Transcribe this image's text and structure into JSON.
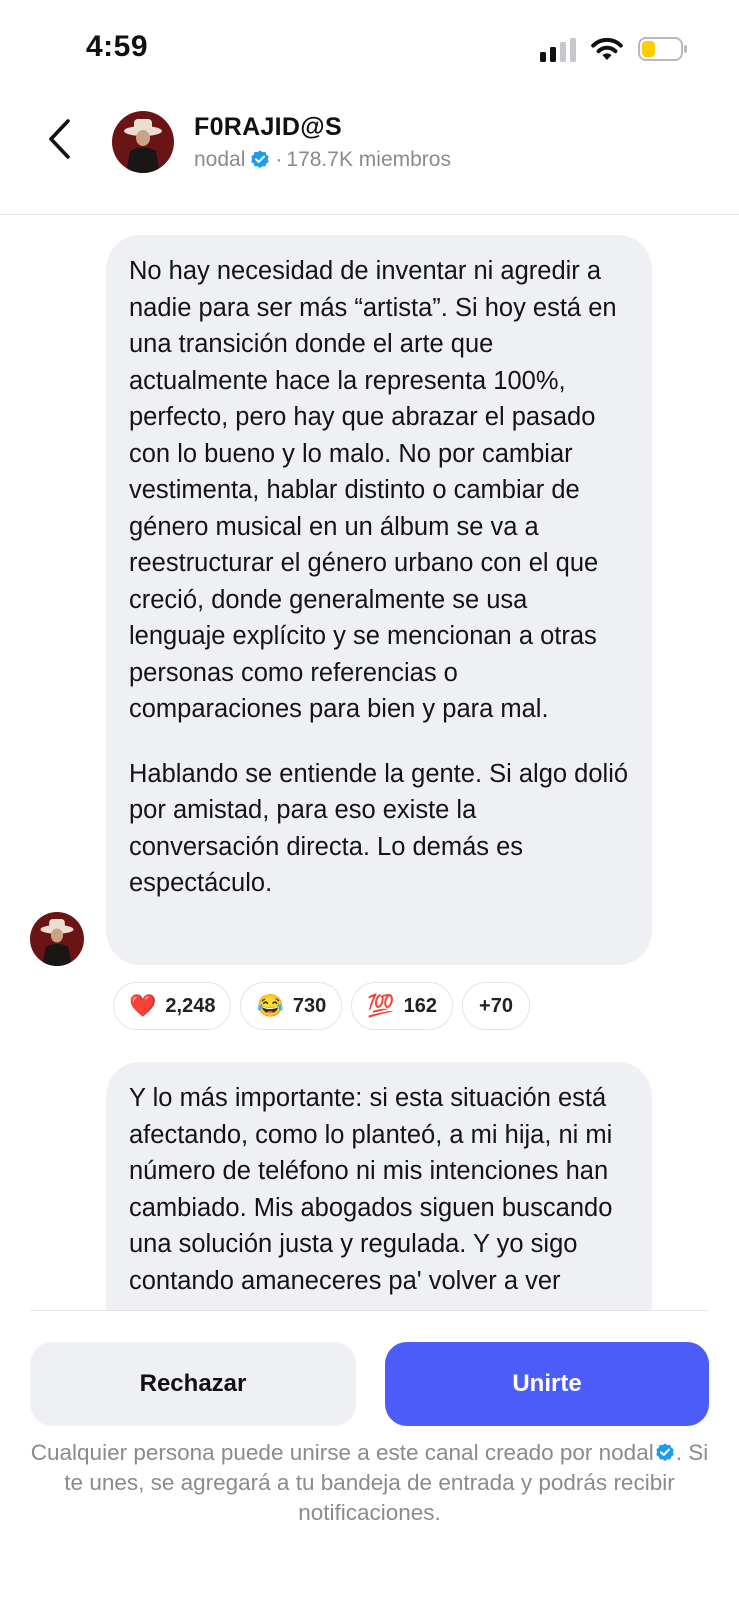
{
  "status_bar": {
    "time": "4:59"
  },
  "header": {
    "title": "F0RAJID@S",
    "creator": "nodal",
    "separator": "·",
    "members": "178.7K miembros"
  },
  "messages": [
    {
      "paragraphs": [
        "No hay necesidad de inventar ni agredir a nadie para ser más “artista”. Si hoy está en una transición donde el arte que actualmente hace la representa 100%, perfecto, pero hay que abrazar el pasado con lo bueno y lo malo. No por cambiar vestimenta, hablar distinto o cambiar de género musical en un álbum se va a reestructurar el género urbano con el que creció, donde generalmente se usa lenguaje explícito y se mencionan a otras personas como referencias o comparaciones para bien y para mal.",
        "Hablando se entiende la gente. Si algo dolió por amistad, para eso existe la conversación directa. Lo demás es espectáculo."
      ],
      "reactions": [
        {
          "emoji": "❤️",
          "count": "2,248"
        },
        {
          "emoji": "😂",
          "count": "730"
        },
        {
          "emoji": "💯",
          "count": "162"
        }
      ],
      "more_reactions": "+70"
    },
    {
      "paragraphs": [
        "Y lo más importante: si esta situación está afectando, como lo planteó, a mi hija, ni mi número de teléfono ni mis intenciones han cambiado. Mis abogados siguen buscando una solución justa y regulada. Y yo sigo contando amaneceres pa' volver a ver"
      ]
    }
  ],
  "actions": {
    "reject_label": "Rechazar",
    "join_label": "Unirte"
  },
  "footnote": {
    "before": "Cualquier persona puede unirse a este canal creado por",
    "creator": "nodal",
    "after": ". Si te unes, se agregará a tu bandeja de entrada y podrás recibir notificaciones."
  },
  "colors": {
    "accent": "#4c5cf8",
    "verified": "#1d9bf0",
    "bubble": "#eef0f3",
    "muted_text": "#8a8a8f",
    "battery_fill": "#ffcc00"
  },
  "icons": {
    "back": "chevron-left-icon",
    "verified": "verified-badge-icon",
    "signal": "cellular-signal-icon",
    "wifi": "wifi-icon",
    "battery": "battery-low-icon"
  }
}
